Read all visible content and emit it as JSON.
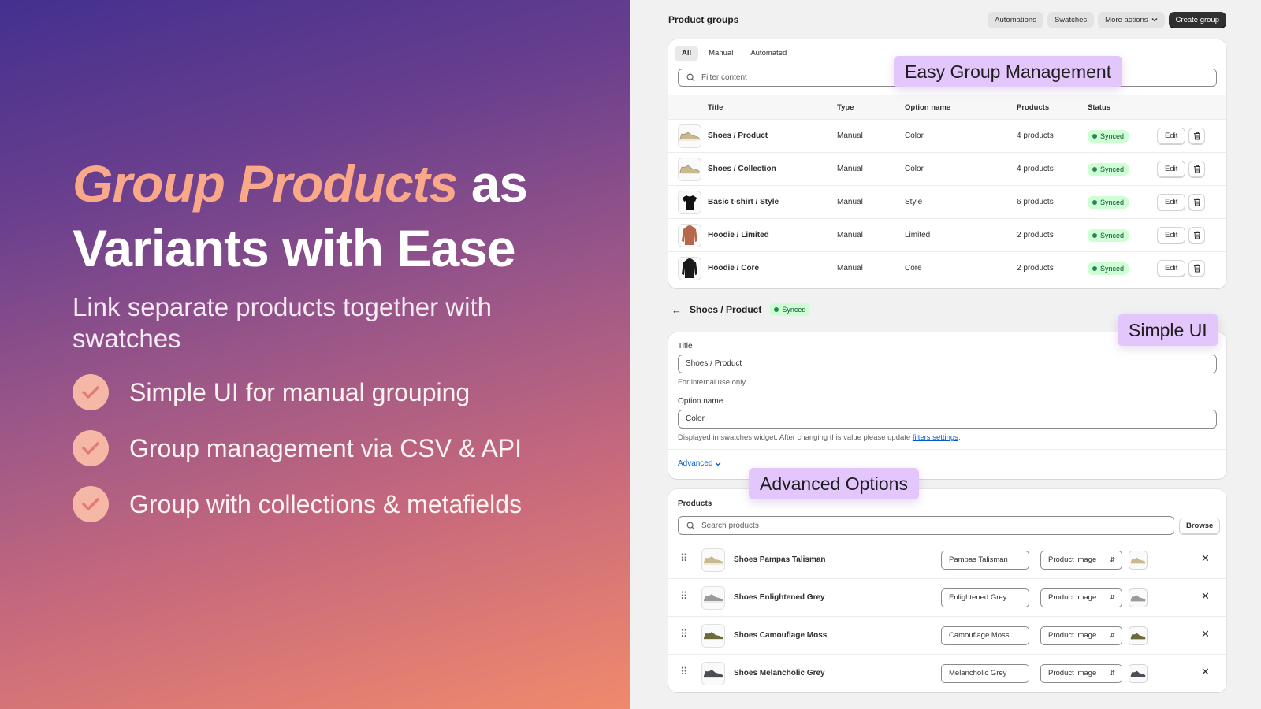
{
  "promo": {
    "headline_accent": "Group Products",
    "headline_rest_1": "as",
    "headline_rest_2": "Variants with Ease",
    "subhead": "Link separate products together with swatches",
    "features": [
      "Simple UI for manual grouping",
      "Group management via CSV & API",
      "Group with collections & metafields"
    ],
    "colors": {
      "accent": "#f9a98a",
      "gradient_start": "#44308f",
      "gradient_end": "#f08a6c"
    }
  },
  "header": {
    "title": "Product groups",
    "buttons": {
      "automations": "Automations",
      "swatches": "Swatches",
      "more_actions": "More actions",
      "create_group": "Create group"
    }
  },
  "groups": {
    "tabs": [
      "All",
      "Manual",
      "Automated"
    ],
    "filter_placeholder": "Filter content",
    "columns": {
      "title": "Title",
      "type": "Type",
      "option_name": "Option name",
      "products": "Products",
      "status": "Status"
    },
    "rows": [
      {
        "title": "Shoes / Product",
        "type": "Manual",
        "option": "Color",
        "products": "4 products",
        "status": "Synced",
        "thumb": "shoe-beige"
      },
      {
        "title": "Shoes / Collection",
        "type": "Manual",
        "option": "Color",
        "products": "4 products",
        "status": "Synced",
        "thumb": "shoe-beige"
      },
      {
        "title": "Basic t-shirt / Style",
        "type": "Manual",
        "option": "Style",
        "products": "6 products",
        "status": "Synced",
        "thumb": "tshirt-black"
      },
      {
        "title": "Hoodie / Limited",
        "type": "Manual",
        "option": "Limited",
        "products": "2 products",
        "status": "Synced",
        "thumb": "hoodie-rust"
      },
      {
        "title": "Hoodie / Core",
        "type": "Manual",
        "option": "Core",
        "products": "2 products",
        "status": "Synced",
        "thumb": "hoodie-black"
      }
    ],
    "edit_label": "Edit"
  },
  "detail": {
    "title": "Shoes / Product",
    "status": "Synced",
    "title_label": "Title",
    "title_value": "Shoes / Product",
    "title_help": "For internal use only",
    "option_label": "Option name",
    "option_value": "Color",
    "option_help": "Displayed in swatches widget. After changing this value please update",
    "option_help_link": "filters settings",
    "option_help_end": ".",
    "advanced_label": "Advanced"
  },
  "products": {
    "title": "Products",
    "search_placeholder": "Search products",
    "browse_label": "Browse",
    "items": [
      {
        "name": "Shoes Pampas Talisman",
        "swatch_label": "Pampas Talisman",
        "swatch_type": "Product image",
        "color": "#c9b98f"
      },
      {
        "name": "Shoes Enlightened Grey",
        "swatch_label": "Enlightened Grey",
        "swatch_type": "Product image",
        "color": "#9a9a9a"
      },
      {
        "name": "Shoes Camouflage Moss",
        "swatch_label": "Camouflage Moss",
        "swatch_type": "Product image",
        "color": "#6d6a3a"
      },
      {
        "name": "Shoes Melancholic Grey",
        "swatch_label": "Melancholic Grey",
        "swatch_type": "Product image",
        "color": "#4a4e55"
      }
    ]
  },
  "callouts": {
    "group_management": "Easy Group Management",
    "simple_ui": "Simple UI",
    "advanced_options": "Advanced Options"
  }
}
